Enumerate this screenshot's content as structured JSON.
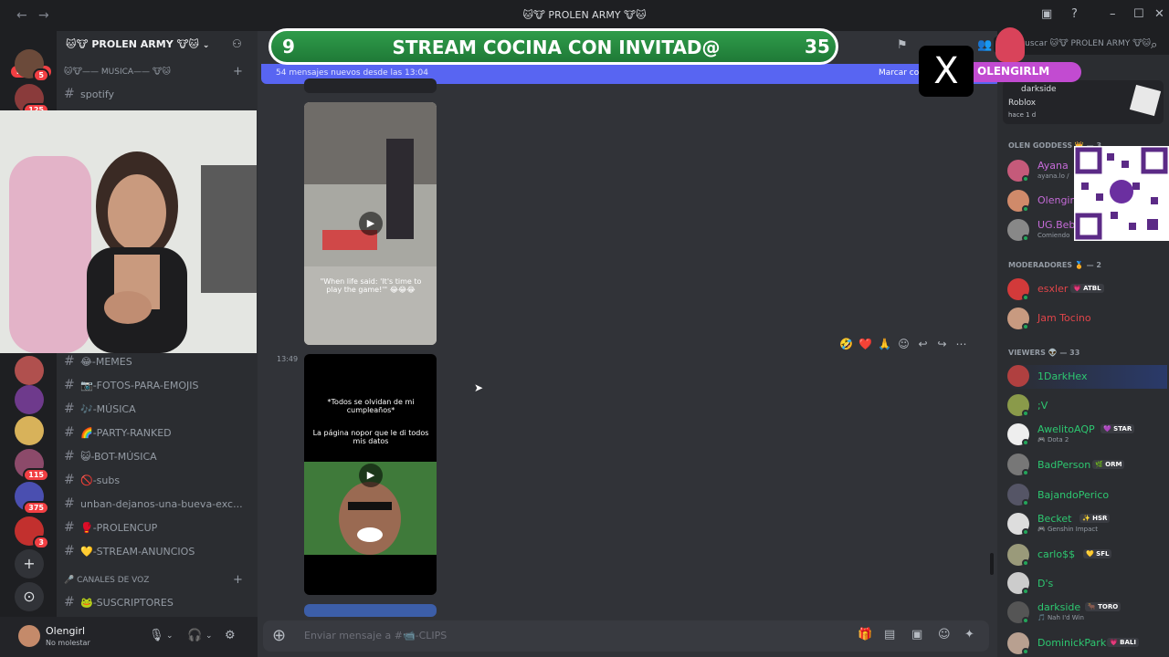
{
  "window": {
    "title": "🐱🐮 PROLEN ARMY 🐮🐱",
    "back": "←",
    "forward": "→"
  },
  "rail": {
    "new_pill": "NUEVO",
    "badges": [
      "5",
      "125",
      "115",
      "375",
      "3"
    ],
    "add": "+",
    "explore": "⊙"
  },
  "server": {
    "name": "🐱🐮 PROLEN ARMY 🐮🐱",
    "top_category": "🐱🐮—— MUSICA—— 🐮🐱",
    "top_channel": "spotify",
    "channels": [
      "😂-MEMES",
      "📷-FOTOS-PARA-EMOJIS",
      "🎶-MÚSICA",
      "🌈-PARTY-RANKED",
      "😺-BOT-MÚSICA",
      "🚫-subs",
      "unban-dejanos-una-bueva-exc...",
      "🥊-PROLENCUP",
      "💛-STREAM-ANUNCIOS"
    ],
    "voice_category": "CANALES DE VOZ",
    "voice_channels": [
      "🐸-SUSCRIPTORES"
    ]
  },
  "user": {
    "name": "Olengirl",
    "status": "No molestar"
  },
  "overlay": {
    "left_number": "9",
    "text": "STREAM COCINA CON INVITAD@",
    "right_number": "35"
  },
  "chat": {
    "new_messages": "54 mensajes nuevos desde las 13:04",
    "mark_read": "Marcar co",
    "timestamp": "13:49",
    "video1_caption": "\"When life said: 'It's time to play the game!'\" 😂😂😂",
    "video2_caption_1": "*Todos se olvidan de mi cumpleaños*",
    "video2_caption_2": "La página nopor que le di todos mis datos",
    "composer_placeholder": "Enviar mensaje a #📹-CLIPS",
    "reactions": [
      "🤣",
      "❤️",
      "🙏",
      "☺",
      "↩",
      "↪",
      "⋯"
    ]
  },
  "topbar": {
    "search_placeholder": "Buscar 🐱🐮 PROLEN ARMY 🐮🐱"
  },
  "social": {
    "logo": "X",
    "handle": "OLENGIRLM"
  },
  "members": {
    "activity": {
      "user": "darkside",
      "game": "Roblox",
      "time": "hace 1 d"
    },
    "sections": [
      {
        "title": "OLEN GODDESS 👑 — 3"
      },
      {
        "title": "MODERADORES 🏅 — 2"
      },
      {
        "title": "VIEWERS 👽 — 33"
      }
    ],
    "goddess": [
      {
        "name": "Ayana",
        "sub": "ayana.lo /",
        "color": "#c56bd8"
      },
      {
        "name": "Olengirl",
        "sub": "",
        "color": "#c56bd8"
      },
      {
        "name": "UG.Beb",
        "sub": "Comiendo",
        "color": "#c56bd8"
      }
    ],
    "mods": [
      {
        "name": "esxler",
        "tag": "💗 ATBL",
        "color": "#e0454a"
      },
      {
        "name": "Jam Tocino",
        "tag": "",
        "color": "#e0454a"
      }
    ],
    "viewers": [
      {
        "name": "1DarkHex",
        "tag": "",
        "sub": ""
      },
      {
        "name": ";V",
        "tag": "",
        "sub": ""
      },
      {
        "name": "AwelitoAQP",
        "tag": "💜 STAR",
        "sub": "🎮 Dota 2"
      },
      {
        "name": "BadPerson",
        "tag": "🌿 ORM",
        "sub": ""
      },
      {
        "name": "BajandoPerico",
        "tag": "",
        "sub": ""
      },
      {
        "name": "Becket",
        "tag": "✨ HSR",
        "sub": "🎮 Genshin Impact"
      },
      {
        "name": "carlo$$",
        "tag": "💛 SFL",
        "sub": ""
      },
      {
        "name": "D's",
        "tag": "",
        "sub": ""
      },
      {
        "name": "darkside",
        "tag": "🐂 TORO",
        "sub": "🎵 Nah I'd Win"
      },
      {
        "name": "DominickPark",
        "tag": "💗 BALI",
        "sub": ""
      }
    ]
  },
  "colors": {
    "viewer_name": "#2dc770",
    "accent": "#5865f2",
    "overlay_green": "#2f9c4a"
  }
}
